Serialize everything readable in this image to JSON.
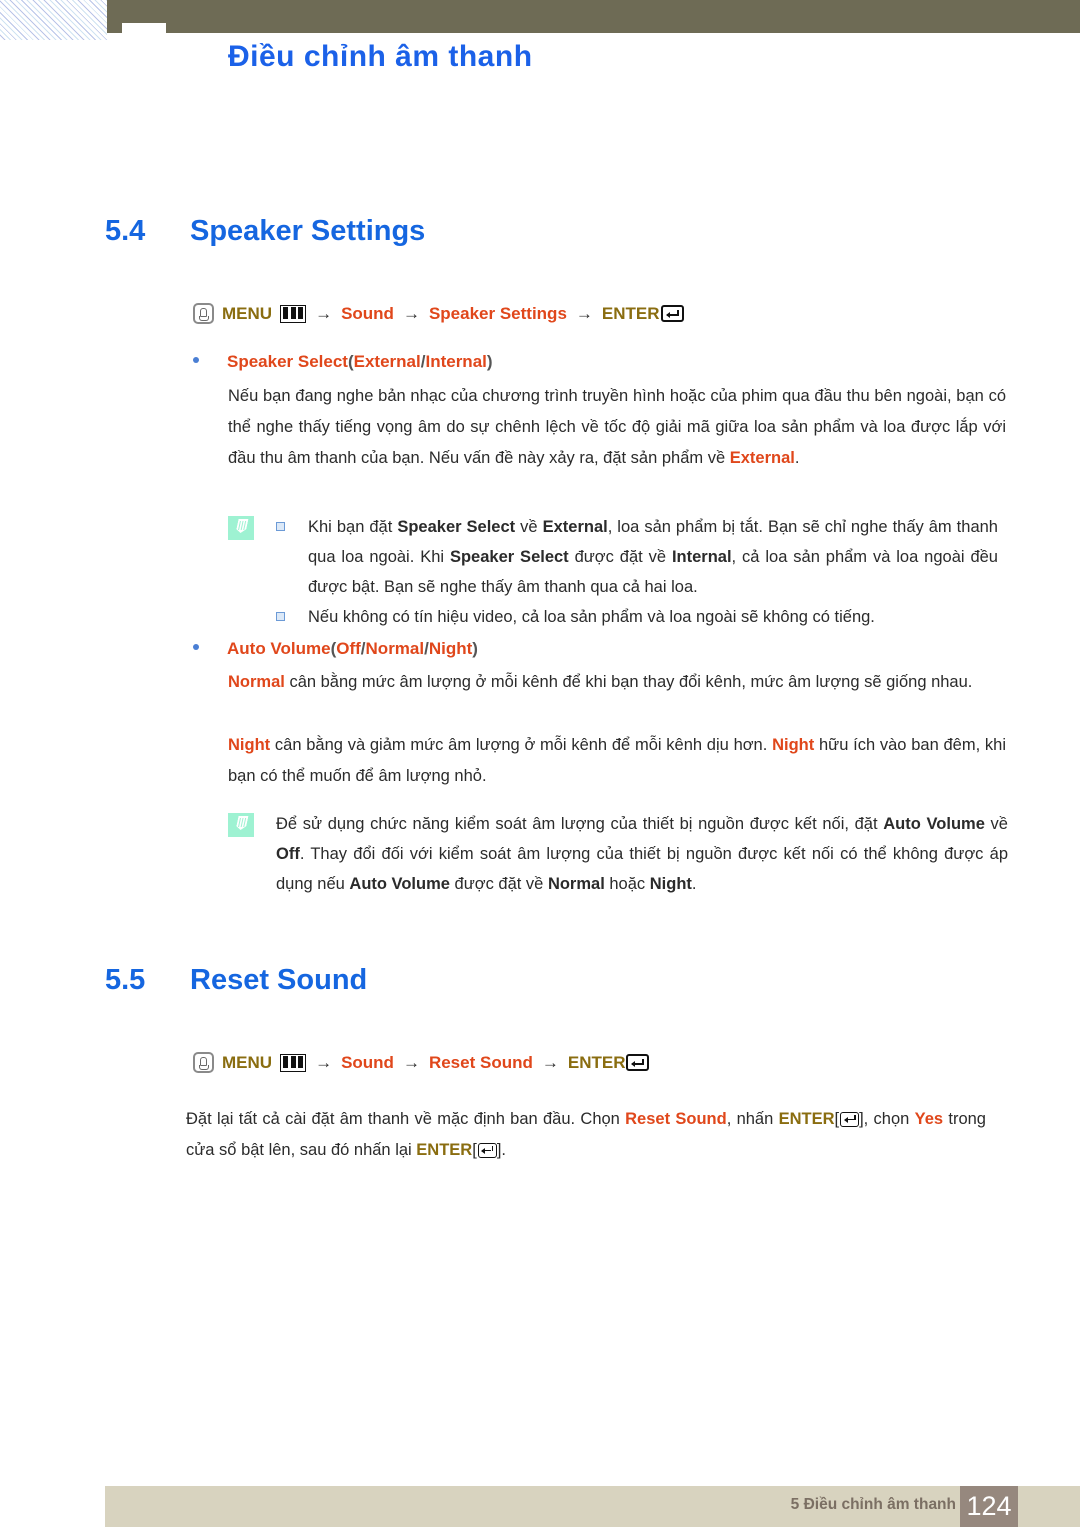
{
  "header": {
    "document_title": "Điều chỉnh âm thanh"
  },
  "sections": [
    {
      "number": "5.4",
      "title": "Speaker Settings",
      "menu_path": {
        "hand_icon": "hand-press-icon",
        "menu_label": "MENU",
        "grid_icon": "menu-grid-icon",
        "arrow": "→",
        "step1": "Sound",
        "step2": "Speaker Settings",
        "enter_label": "ENTER",
        "enter_icon": "enter-key-icon"
      },
      "bullet1": {
        "name": "Speaker Select",
        "open_paren": "(",
        "opt1": "External",
        "slash": " / ",
        "opt2": "Internal",
        "close_paren": ")"
      },
      "para1_a": "Nếu bạn đang nghe bản nhạc của chương trình truyền hình hoặc của phim qua đầu thu bên ngoài, bạn có thể nghe thấy tiếng vọng âm do sự chênh lệch về tốc độ giải mã giữa loa sản phẩm và loa được lắp với đầu thu âm thanh của bạn. Nếu vấn đề này xảy ra, đặt sản phẩm về ",
      "para1_kw": "External",
      "para1_b": ".",
      "note1_item1_parts": {
        "t1": "Khi bạn đặt ",
        "k1": "Speaker Select",
        "t2": " về ",
        "k2": "External",
        "t3": ", loa sản phẩm bị tắt. Bạn sẽ chỉ nghe thấy âm thanh qua loa ngoài. Khi ",
        "k3": "Speaker Select",
        "t4": " được đặt về ",
        "k4": "Internal",
        "t5": ", cả loa sản phẩm và loa ngoài đều được bật. Bạn sẽ nghe thấy âm thanh qua cả hai loa."
      },
      "note1_item2": "Nếu không có tín hiệu video, cả loa sản phẩm và loa ngoài sẽ không có tiếng.",
      "bullet2": {
        "name": "Auto Volume",
        "open_paren": "(",
        "opt1": "Off",
        "slash1": " / ",
        "opt2": "Normal",
        "slash2": " / ",
        "opt3": "Night",
        "close_paren": ")"
      },
      "para2_kw": "Normal",
      "para2_text": " cân bằng mức âm lượng ở mỗi kênh để khi bạn thay đổi kênh, mức âm lượng sẽ giống nhau.",
      "para3_kw1": "Night",
      "para3_t1": " cân bằng và giảm mức âm lượng ở mỗi kênh để mỗi kênh dịu hơn. ",
      "para3_kw2": "Night",
      "para3_t2": " hữu ích vào ban đêm, khi bạn có thể muốn để âm lượng nhỏ.",
      "note2_parts": {
        "t1": "Để sử dụng chức năng kiểm soát âm lượng của thiết bị nguồn được kết nối, đặt ",
        "k1": "Auto Volume",
        "t2": " về ",
        "k2": "Off",
        "t3": ". Thay đổi đối với kiểm soát âm lượng của thiết bị nguồn được kết nối có thể không được áp dụng nếu ",
        "k3": "Auto Volume",
        "t4": " được đặt về ",
        "k4": "Normal",
        "t5": " hoặc ",
        "k5": "Night",
        "t6": "."
      }
    },
    {
      "number": "5.5",
      "title": "Reset Sound",
      "menu_path": {
        "hand_icon": "hand-press-icon",
        "menu_label": "MENU",
        "grid_icon": "menu-grid-icon",
        "arrow": "→",
        "step1": "Sound",
        "step2": "Reset Sound",
        "enter_label": "ENTER",
        "enter_icon": "enter-key-icon"
      },
      "para_parts": {
        "t1": "Đặt lại tất cả cài đặt âm thanh về mặc định ban đầu. Chọn ",
        "k1": "Reset Sound",
        "t2": ", nhấn ",
        "k2": "ENTER",
        "br1": "[",
        "br2": "], chọn ",
        "k3": "Yes",
        "t3": " trong cửa sổ bật lên, sau đó nhấn lại ",
        "k4": "ENTER",
        "br3": "[",
        "br4": "]."
      }
    }
  ],
  "footer": {
    "chapter_label": "5 Điều chỉnh âm thanh",
    "page_number": "124"
  },
  "colors": {
    "heading_blue": "#1566e0",
    "keyword_orange": "#e0471b",
    "keyword_olive": "#8a6d10",
    "olive_bar": "#6e6b55",
    "footer_bar": "#d8d3bf",
    "footer_page_box": "#96887e",
    "note_icon_green": "#9ef2d2"
  }
}
